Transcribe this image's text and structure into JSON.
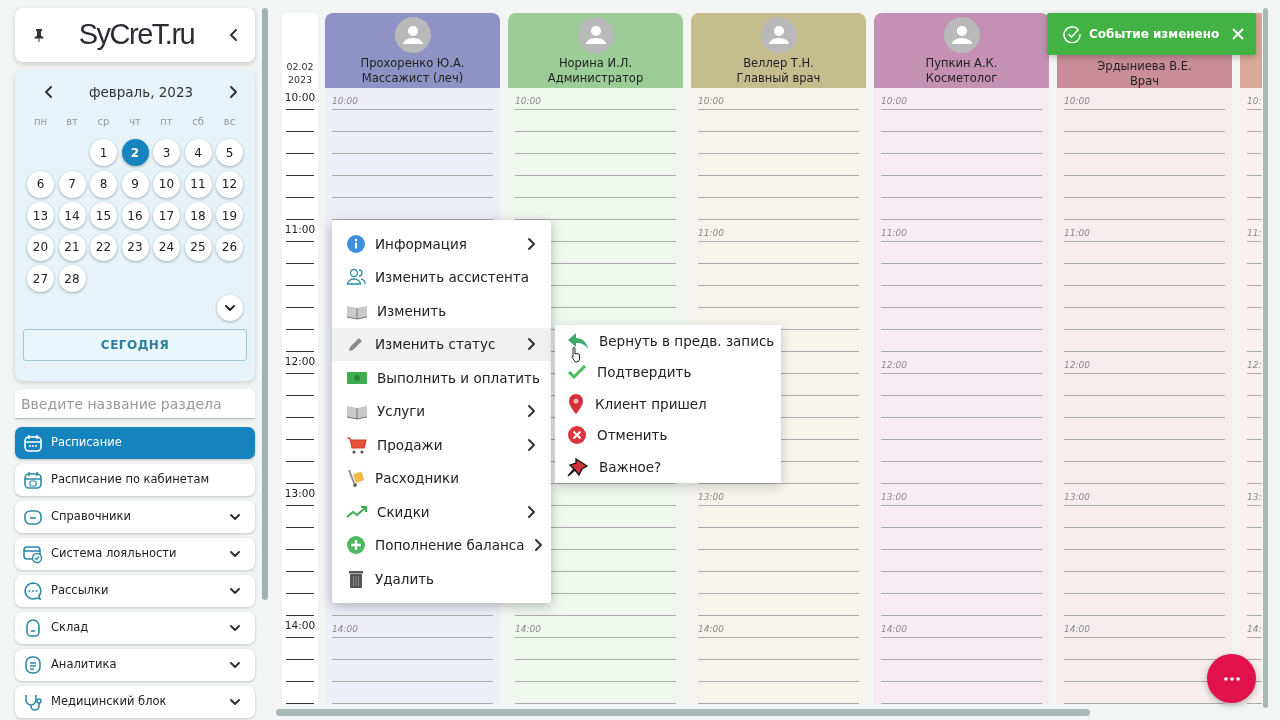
{
  "sidebar": {
    "logo": "SyCreT.ru",
    "calendar": {
      "month": "февраль, 2023",
      "weekdays": [
        "пн",
        "вт",
        "ср",
        "чт",
        "пт",
        "сб",
        "вс"
      ],
      "weeks": [
        {
          "starts_midweek": true,
          "days": [
            {
              "text": "1",
              "selected": false
            },
            {
              "text": "2",
              "selected": true
            },
            {
              "text": "3",
              "selected": false
            },
            {
              "text": "4",
              "selected": false
            },
            {
              "text": "5",
              "selected": false
            }
          ]
        },
        {
          "days": [
            {
              "text": "6",
              "selected": false
            },
            {
              "text": "7",
              "selected": false
            },
            {
              "text": "8",
              "selected": false
            },
            {
              "text": "9",
              "selected": false
            },
            {
              "text": "10",
              "selected": false
            },
            {
              "text": "11",
              "selected": false
            },
            {
              "text": "12",
              "selected": false
            }
          ]
        },
        {
          "days": [
            {
              "text": "13",
              "selected": false
            },
            {
              "text": "14",
              "selected": false
            },
            {
              "text": "15",
              "selected": false
            },
            {
              "text": "16",
              "selected": false
            },
            {
              "text": "17",
              "selected": false
            },
            {
              "text": "18",
              "selected": false
            },
            {
              "text": "19",
              "selected": false
            }
          ]
        },
        {
          "days": [
            {
              "text": "20",
              "selected": false
            },
            {
              "text": "21",
              "selected": false
            },
            {
              "text": "22",
              "selected": false
            },
            {
              "text": "23",
              "selected": false
            },
            {
              "text": "24",
              "selected": false
            },
            {
              "text": "25",
              "selected": false
            },
            {
              "text": "26",
              "selected": false
            }
          ]
        },
        {
          "starts_midweek": false,
          "days": [
            {
              "text": "27",
              "selected": false
            },
            {
              "text": "28",
              "selected": false
            }
          ]
        }
      ],
      "today_button": "СЕГОДНЯ"
    },
    "search": {
      "placeholder": "Введите название раздела"
    },
    "nav": [
      {
        "label": "Расписание",
        "selected": true,
        "expandable": false
      },
      {
        "label": "Расписание по кабинетам",
        "selected": false,
        "expandable": false
      },
      {
        "label": "Справочники",
        "selected": false,
        "expandable": true
      },
      {
        "label": "Система лояльности",
        "selected": false,
        "expandable": true
      },
      {
        "label": "Рассылки",
        "selected": false,
        "expandable": true
      },
      {
        "label": "Склад",
        "selected": false,
        "expandable": true
      },
      {
        "label": "Аналитика",
        "selected": false,
        "expandable": true
      },
      {
        "label": "Медицинский блок",
        "selected": false,
        "expandable": true
      }
    ]
  },
  "schedule": {
    "date_day": "02.02",
    "date_year": "2023",
    "hours": [
      "10:00",
      "11:00",
      "12:00",
      "13:00",
      "14:00"
    ],
    "columns": [
      {
        "avatar": true,
        "name": "Прохоренко Ю.А.",
        "role": "Массажист (леч)",
        "color": "#8e92c4",
        "marks": [
          {
            "text": "10:00"
          },
          {
            "covered": true
          },
          {
            "covered": true
          },
          {
            "covered": true
          },
          {
            "text": "14:00"
          }
        ]
      },
      {
        "avatar": true,
        "name": "Норина И.Л.",
        "role": "Администратор",
        "color": "#9ccc98",
        "marks": [
          {
            "text": "10:00"
          },
          {
            "covered": true
          },
          {
            "covered": true
          },
          {
            "covered": true
          },
          {
            "text": "14:00"
          }
        ]
      },
      {
        "avatar": true,
        "name": "Веллер Т.Н.",
        "role": "Главный врач",
        "color": "#c5bd8e",
        "marks": [
          {
            "text": "10:00"
          },
          {
            "text": "11:00"
          },
          {
            "covered": true
          },
          {
            "text": "13:00"
          },
          {
            "text": "14:00"
          }
        ]
      },
      {
        "avatar": true,
        "name": "Пупкин А.К.",
        "role": "Косметолог",
        "color": "#c491b4",
        "marks": [
          {
            "text": "10:00"
          },
          {
            "text": "11:00"
          },
          {
            "text": "12:00"
          },
          {
            "text": "13:00"
          },
          {
            "text": "14:00"
          }
        ]
      },
      {
        "name": "Эрдыниева В.Е.",
        "role": "Врач",
        "color": "#c98c9b",
        "marks": [
          {
            "text": "10:00"
          },
          {
            "text": "11:00"
          },
          {
            "text": "12:00"
          },
          {
            "text": "13:00"
          },
          {
            "text": "14:00"
          }
        ]
      },
      {
        "color": "#d9a99a",
        "marks": [
          {
            "text": "10:"
          },
          {
            "text": "11:"
          },
          {
            "text": "12:"
          },
          {
            "text": "13:"
          },
          {
            "text": "14:"
          }
        ]
      }
    ]
  },
  "context_menu": {
    "items": [
      {
        "label": "Информация",
        "submenu": true,
        "selected": false
      },
      {
        "label": "Изменить ассистента",
        "submenu": false,
        "selected": false
      },
      {
        "label": "Изменить",
        "submenu": false,
        "selected": false
      },
      {
        "label": "Изменить статус",
        "submenu": true,
        "selected": true
      },
      {
        "label": "Выполнить и оплатить",
        "submenu": false,
        "selected": false
      },
      {
        "label": "Услуги",
        "submenu": true,
        "selected": false
      },
      {
        "label": "Продажи",
        "submenu": true,
        "selected": false
      },
      {
        "label": "Расходники",
        "submenu": false,
        "selected": false
      },
      {
        "label": "Скидки",
        "submenu": true,
        "selected": false
      },
      {
        "label": "Пополнение баланса",
        "submenu": true,
        "selected": false
      },
      {
        "label": "Удалить",
        "submenu": false,
        "selected": false
      }
    ],
    "submenu": [
      {
        "label": "Вернуть в предв. запись",
        "selected": false
      },
      {
        "label": "Подтвердить",
        "selected": false
      },
      {
        "label": "Клиент пришел",
        "selected": false
      },
      {
        "label": "Отменить",
        "selected": false
      },
      {
        "label": "Важное?",
        "selected": false
      }
    ]
  },
  "toast": {
    "text": "Событие изменено"
  }
}
